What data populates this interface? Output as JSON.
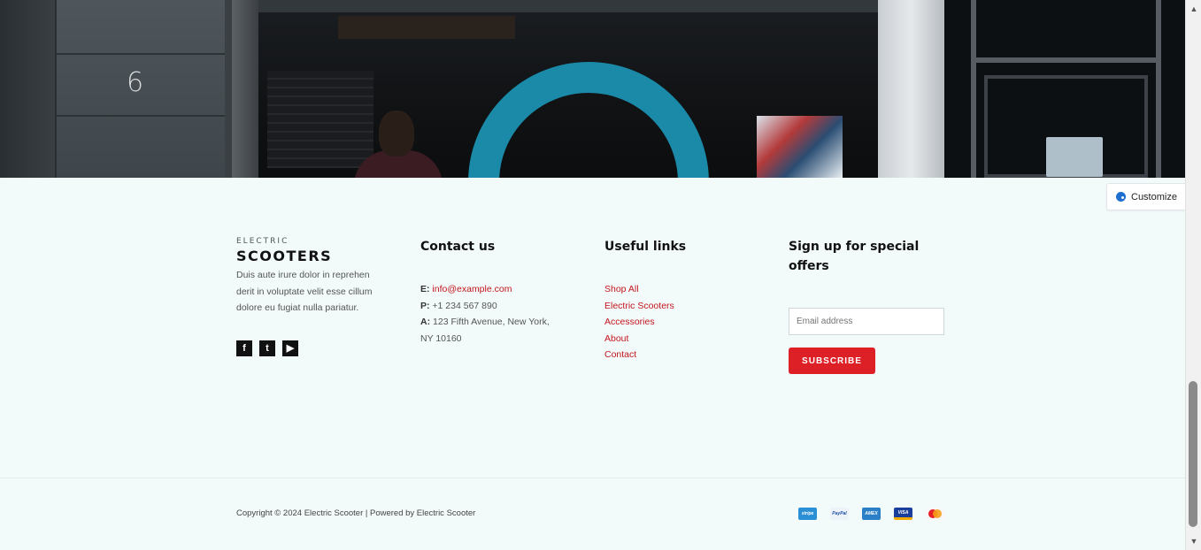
{
  "brand": {
    "small": "ELECTRIC",
    "big": "SCOOTERS"
  },
  "about": "Duis aute irure dolor in reprehen derit in voluptate velit esse cillum dolore eu fugiat nulla pariatur.",
  "social": [
    {
      "icon": "facebook-icon",
      "glyph": "f"
    },
    {
      "icon": "twitter-icon",
      "glyph": "t"
    },
    {
      "icon": "youtube-icon",
      "glyph": "▶"
    }
  ],
  "hero": {
    "house_number": "6"
  },
  "contact": {
    "title": "Contact us",
    "email_label": "E:",
    "email": "info@example.com",
    "phone_label": "P:",
    "phone": "+1 234 567 890",
    "address_label": "A:",
    "address": "123 Fifth Avenue, New York, NY 10160"
  },
  "useful": {
    "title": "Useful links",
    "links": [
      "Shop All",
      "Electric Scooters",
      "Accessories",
      "About",
      "Contact"
    ]
  },
  "signup": {
    "title": "Sign up for special offers",
    "placeholder": "Email address",
    "button": "SUBSCRIBE"
  },
  "customize": {
    "label": "Customize"
  },
  "copyright": "Copyright © 2024 Electric Scooter | Powered by Electric Scooter",
  "payments": [
    {
      "icon": "stripe-icon",
      "text": "stripe"
    },
    {
      "icon": "paypal-icon",
      "text": "PayPal"
    },
    {
      "icon": "amex-icon",
      "text": "AMEX"
    },
    {
      "icon": "visa-icon",
      "text": "VISA"
    },
    {
      "icon": "mastercard-icon",
      "text": ""
    }
  ],
  "colors": {
    "accent": "#dd1f26",
    "link": "#c4161c",
    "background": "#f2fafa",
    "ring": "#1a8aa8"
  }
}
